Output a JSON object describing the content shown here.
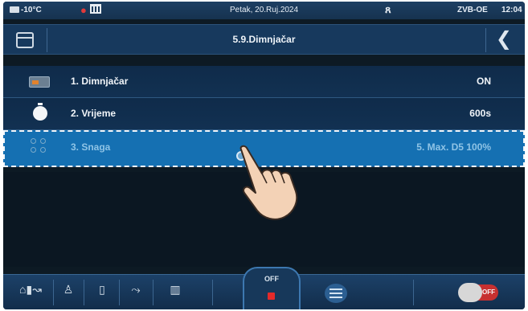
{
  "status": {
    "temperature": "-10°C",
    "date": "Petak, 20.Ruj.2024",
    "device": "ZVB-OE",
    "time": "12:04"
  },
  "titlebar": {
    "title": "5.9.Dimnjačar",
    "back_glyph": "❮"
  },
  "rows": [
    {
      "label": "1.  Dimnjačar",
      "value": "ON",
      "icon": "chimney-card-icon"
    },
    {
      "label": "2.  Vrijeme",
      "value": "600s",
      "icon": "timer-icon"
    },
    {
      "label": "3.  Snaga",
      "value": "5. Max. D5 100%",
      "icon": "power-levels-icon"
    }
  ],
  "bottom": {
    "off_label": "OFF",
    "toggle_label": "OFF"
  }
}
